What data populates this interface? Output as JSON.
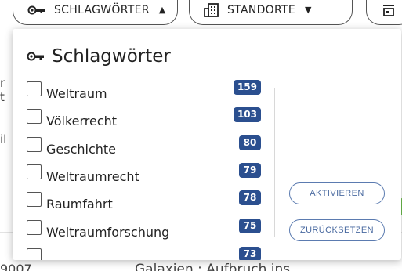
{
  "filters": [
    {
      "label": "SCHLAGWÖRTER",
      "caret": "▲",
      "icon": "key-icon"
    },
    {
      "label": "STANDORTE",
      "caret": "▼",
      "icon": "building-icon"
    },
    {
      "label": "",
      "icon": "toggle-icon"
    }
  ],
  "panel": {
    "title": "Schlagwörter",
    "title_icon": "key-icon",
    "items": [
      {
        "label": "Weltraum",
        "count": "159"
      },
      {
        "label": "Völkerrecht",
        "count": "103"
      },
      {
        "label": "Geschichte",
        "count": "80"
      },
      {
        "label": "Weltraumrecht",
        "count": "79"
      },
      {
        "label": "Raumfahrt",
        "count": "78"
      },
      {
        "label": "Weltraumforschung",
        "count": "75"
      },
      {
        "label": "",
        "count": "73"
      }
    ],
    "activate_label": "AKTIVIEREN",
    "reset_label": "ZURÜCKSETZEN"
  },
  "background": {
    "frag_r": "r",
    "frag_t": "t",
    "frag_il": "il",
    "bottom_left": "9007...",
    "bottom_right": "Galaxien : Aufbruch ins..."
  },
  "colors": {
    "badge": "#2b4f8f",
    "button_text": "#4a6aa0",
    "accent_green": "#6fbf4f"
  }
}
